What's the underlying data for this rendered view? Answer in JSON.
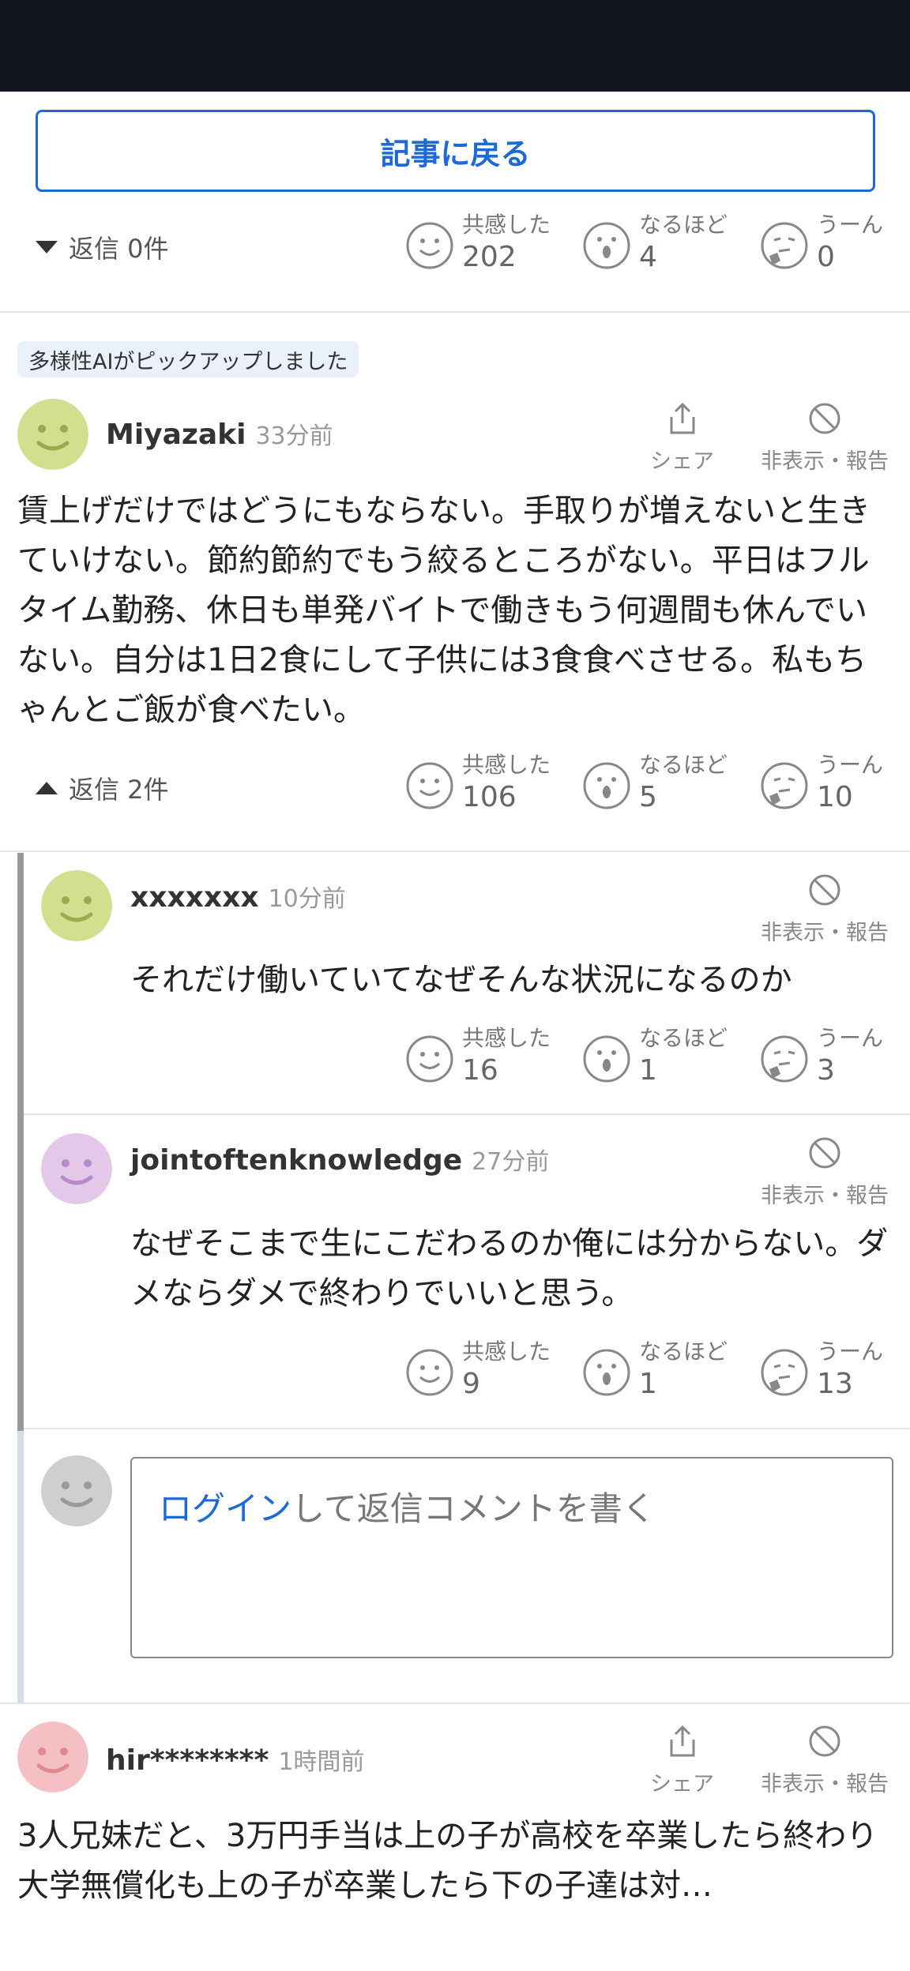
{
  "back_button": "記事に戻る",
  "labels": {
    "empathy": "共感した",
    "naruhodo": "なるほど",
    "uun": "うーん",
    "share": "シェア",
    "hide_report": "非表示・報告"
  },
  "top_comment": {
    "replies_label": "返信 0件",
    "empathy": "202",
    "naruhodo": "4",
    "uun": "0"
  },
  "pickup_badge": "多様性AIがピックアップしました",
  "comment1": {
    "username": "Miyazaki",
    "time": "33分前",
    "body": "賃上げだけではどうにもならない。手取りが増えないと生きていけない。節約節約でもう絞るところがない。平日はフルタイム勤務、休日も単発バイトで働きもう何週間も休んでいない。自分は1日2食にして子供には3食食べさせる。私もちゃんとご飯が食べたい。",
    "replies_label": "返信 2件",
    "empathy": "106",
    "naruhodo": "5",
    "uun": "10"
  },
  "replies": [
    {
      "username": "xxxxxxx",
      "time": "10分前",
      "body": "それだけ働いていてなぜそんな状況になるのか",
      "empathy": "16",
      "naruhodo": "1",
      "uun": "3"
    },
    {
      "username": "jointoftenknowledge",
      "time": "27分前",
      "body": "なぜそこまで生にこだわるのか俺には分からない。ダメならダメで終わりでいいと思う。",
      "empathy": "9",
      "naruhodo": "1",
      "uun": "13"
    }
  ],
  "reply_box": {
    "login_link": "ログイン",
    "prompt": "して返信コメントを書く"
  },
  "comment2": {
    "username": "hir********",
    "time": "1時間前",
    "body": "3人兄妹だと、3万円手当は上の子が高校を卒業したら終わり　大学無償化も上の子が卒業したら下の子達は対…"
  },
  "colors": {
    "accent": "#1d6ad7",
    "avatar_green": "#d3df8f",
    "avatar_purple": "#e3c8ea",
    "avatar_gray": "#cfcfcf",
    "avatar_pink": "#f5c0c3"
  }
}
